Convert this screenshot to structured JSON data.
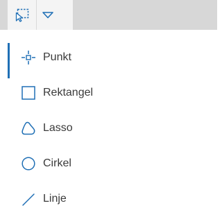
{
  "toolbar": {
    "select_tool_icon": "select-by-rectangle-icon",
    "dropdown_icon": "chevron-down-icon",
    "accent_color": "#1f6fb5"
  },
  "menu": {
    "items": [
      {
        "label": "Punkt",
        "icon": "point-crosshair-icon",
        "active": true
      },
      {
        "label": "Rektangel",
        "icon": "rectangle-icon",
        "active": false
      },
      {
        "label": "Lasso",
        "icon": "lasso-icon",
        "active": false
      },
      {
        "label": "Cirkel",
        "icon": "circle-icon",
        "active": false
      },
      {
        "label": "Linje",
        "icon": "line-icon",
        "active": false
      }
    ]
  }
}
